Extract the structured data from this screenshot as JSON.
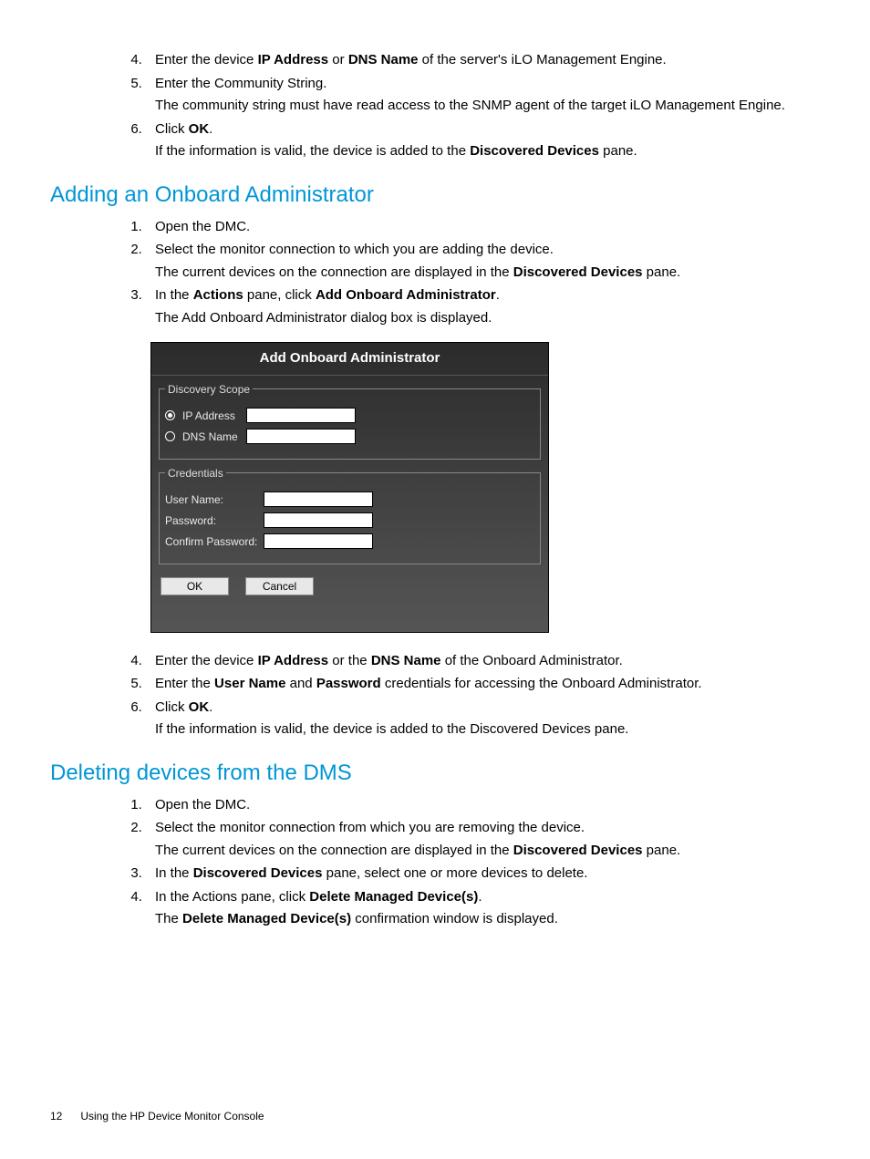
{
  "steps_top": [
    {
      "n": "4.",
      "pre": "Enter the device ",
      "b1": "IP Address",
      "mid": " or ",
      "b2": "DNS Name",
      "post": " of the server's iLO Management Engine."
    },
    {
      "n": "5.",
      "text": "Enter the Community String.",
      "sub": "The community string must have read access to the SNMP agent of the target iLO Management Engine."
    },
    {
      "n": "6.",
      "pre": "Click ",
      "b1": "OK",
      "post": ".",
      "sub_pre": "If the information is valid, the device is added to the ",
      "sub_b": "Discovered Devices",
      "sub_post": " pane."
    }
  ],
  "heading1": "Adding an Onboard Administrator",
  "steps_oa_a": [
    {
      "n": "1.",
      "text": "Open the DMC."
    },
    {
      "n": "2.",
      "text": "Select the monitor connection to which you are adding the device.",
      "sub_pre": "The current devices on the connection are displayed in the ",
      "sub_b": "Discovered Devices",
      "sub_post": " pane."
    },
    {
      "n": "3.",
      "pre": "In the ",
      "b1": "Actions",
      "mid": " pane, click ",
      "b2": "Add Onboard Administrator",
      "post": ".",
      "sub": "The Add Onboard Administrator dialog box is displayed."
    }
  ],
  "dialog": {
    "title": "Add Onboard Administrator",
    "legend1": "Discovery Scope",
    "radio1": "IP Address",
    "radio2": "DNS Name",
    "legend2": "Credentials",
    "user": "User Name:",
    "pass": "Password:",
    "confirm": "Confirm Password:",
    "ok": "OK",
    "cancel": "Cancel"
  },
  "steps_oa_b": [
    {
      "n": "4.",
      "pre": "Enter the device ",
      "b1": "IP Address",
      "mid": " or the ",
      "b2": "DNS Name",
      "post": " of the Onboard Administrator."
    },
    {
      "n": "5.",
      "pre": "Enter the ",
      "b1": "User Name",
      "mid": " and ",
      "b2": "Password",
      "post": " credentials for accessing the Onboard Administrator."
    },
    {
      "n": "6.",
      "pre": "Click ",
      "b1": "OK",
      "post": ".",
      "sub": "If the information is valid, the device is added to the Discovered Devices pane."
    }
  ],
  "heading2": "Deleting devices from the DMS",
  "steps_del": [
    {
      "n": "1.",
      "text": "Open the DMC."
    },
    {
      "n": "2.",
      "text": "Select the monitor connection from which you are removing the device.",
      "sub_pre": "The current devices on the connection are displayed in the ",
      "sub_b": "Discovered Devices",
      "sub_post": " pane."
    },
    {
      "n": "3.",
      "pre": "In the ",
      "b1": "Discovered Devices",
      "post": " pane, select one or more devices to delete."
    },
    {
      "n": "4.",
      "pre": "In the Actions pane, click ",
      "b1": "Delete Managed Device(s)",
      "post": ".",
      "sub_pre": "The ",
      "sub_b": "Delete Managed Device(s)",
      "sub_post": " confirmation window is displayed."
    }
  ],
  "footer": {
    "page": "12",
    "text": "Using the HP Device Monitor Console"
  }
}
